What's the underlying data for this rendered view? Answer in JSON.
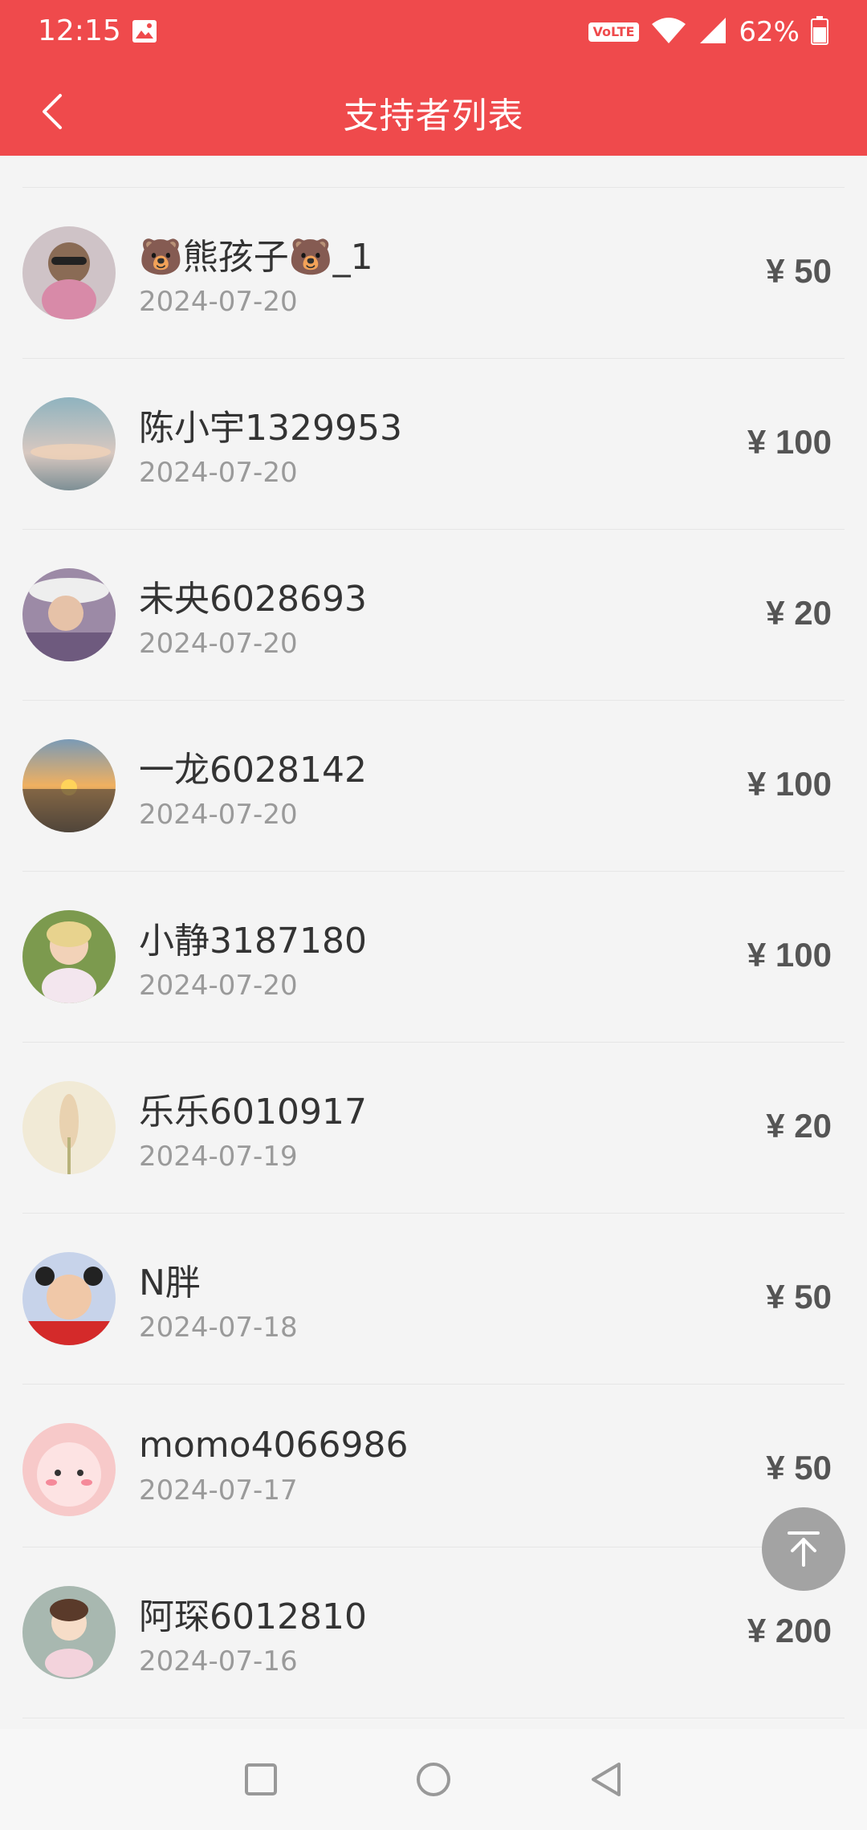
{
  "status_bar": {
    "time": "12:15",
    "volte": "VoLTE",
    "battery": "62%",
    "icons": [
      "gallery-icon",
      "wifi-icon",
      "signal-icon",
      "battery-icon"
    ]
  },
  "header": {
    "title": "支持者列表",
    "back_icon": "chevron-left-icon",
    "accent_color": "#ef4a4c"
  },
  "supporters": [
    {
      "name": "🐻熊孩子🐻_1",
      "date": "2024-07-20",
      "amount": "¥ 50"
    },
    {
      "name": "陈小宇1329953",
      "date": "2024-07-20",
      "amount": "¥ 100"
    },
    {
      "name": "未央6028693",
      "date": "2024-07-20",
      "amount": "¥ 20"
    },
    {
      "name": "一龙6028142",
      "date": "2024-07-20",
      "amount": "¥ 100"
    },
    {
      "name": "小静3187180",
      "date": "2024-07-20",
      "amount": "¥ 100"
    },
    {
      "name": "乐乐6010917",
      "date": "2024-07-19",
      "amount": "¥ 20"
    },
    {
      "name": "N胖",
      "date": "2024-07-18",
      "amount": "¥ 50"
    },
    {
      "name": "momo4066986",
      "date": "2024-07-17",
      "amount": "¥ 50"
    },
    {
      "name": "阿琛6012810",
      "date": "2024-07-16",
      "amount": "¥ 200"
    }
  ],
  "floating": {
    "back_to_top_icon": "arrow-up-to-top-icon"
  },
  "nav_bar": {
    "icons": [
      "recent-apps-icon",
      "home-icon",
      "back-icon"
    ]
  }
}
